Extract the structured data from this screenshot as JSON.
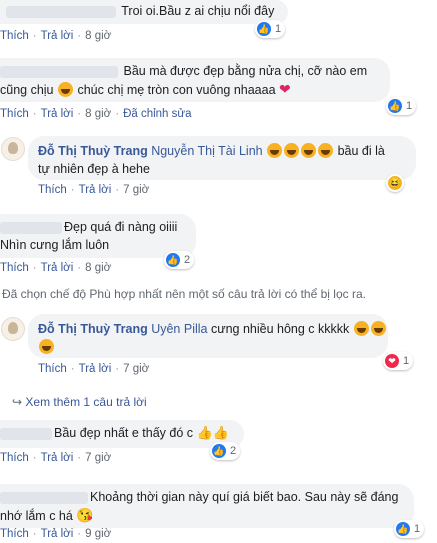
{
  "comments": [
    {
      "text": "Troi oi.Bầu z ai chịu nổi đây",
      "like": "Thích",
      "reply": "Trả lời",
      "time": "8 giờ",
      "reaction_count": "1"
    },
    {
      "text_line1": "Bầu mà được đẹp bằng nửa chị, cỡ nào em",
      "text_line2a": "cũng chịu",
      "text_line2b": "chúc chị mẹ tròn con vuông nhaaaa",
      "like": "Thích",
      "reply": "Trả lời",
      "time": "8 giờ",
      "edited": "Đã chỉnh sửa",
      "reaction_count": "1"
    },
    {
      "author": "Đỗ Thị Thuỳ Trang",
      "mention": "Nguyễn Thị Tài Linh",
      "text_a": "bầu đi là",
      "text_b": "tự nhiên đẹp à hehe",
      "like": "Thích",
      "reply": "Trả lời",
      "time": "7 giờ",
      "reaction_count": ""
    },
    {
      "text_line1": "Đẹp quá đi nàng oiiii",
      "text_line2": "Nhìn cưng lắm luôn",
      "like": "Thích",
      "reply": "Trả lời",
      "time": "8 giờ",
      "reaction_count": "2"
    },
    {
      "author": "Đỗ Thị Thuỳ Trang",
      "mention": "Uyên Pilla",
      "text": "cưng nhiều hông c kkkkk",
      "like": "Thích",
      "reply": "Trả lời",
      "time": "7 giờ",
      "reaction_count": "1"
    },
    {
      "text": "Bầu đẹp nhất e thấy đó c",
      "like": "Thích",
      "reply": "Trả lời",
      "time": "7 giờ",
      "reaction_count": "2"
    },
    {
      "text_line1": "Khoảng thời gian này quí giá biết bao. Sau này sẽ đáng",
      "text_line2": "nhớ lắm c há",
      "like": "Thích",
      "reply": "Trả lời",
      "time": "9 giờ",
      "reaction_count": "1"
    }
  ],
  "notice": "Đã chọn chế độ Phù hợp nhất nên một số câu trả lời có thể bị lọc ra.",
  "more_replies": "Xem thêm 1 câu trả lời",
  "colors": {
    "link": "#385898",
    "bubble": "#f2f3f5",
    "like": "#2078f4",
    "heart": "#f0284a"
  }
}
